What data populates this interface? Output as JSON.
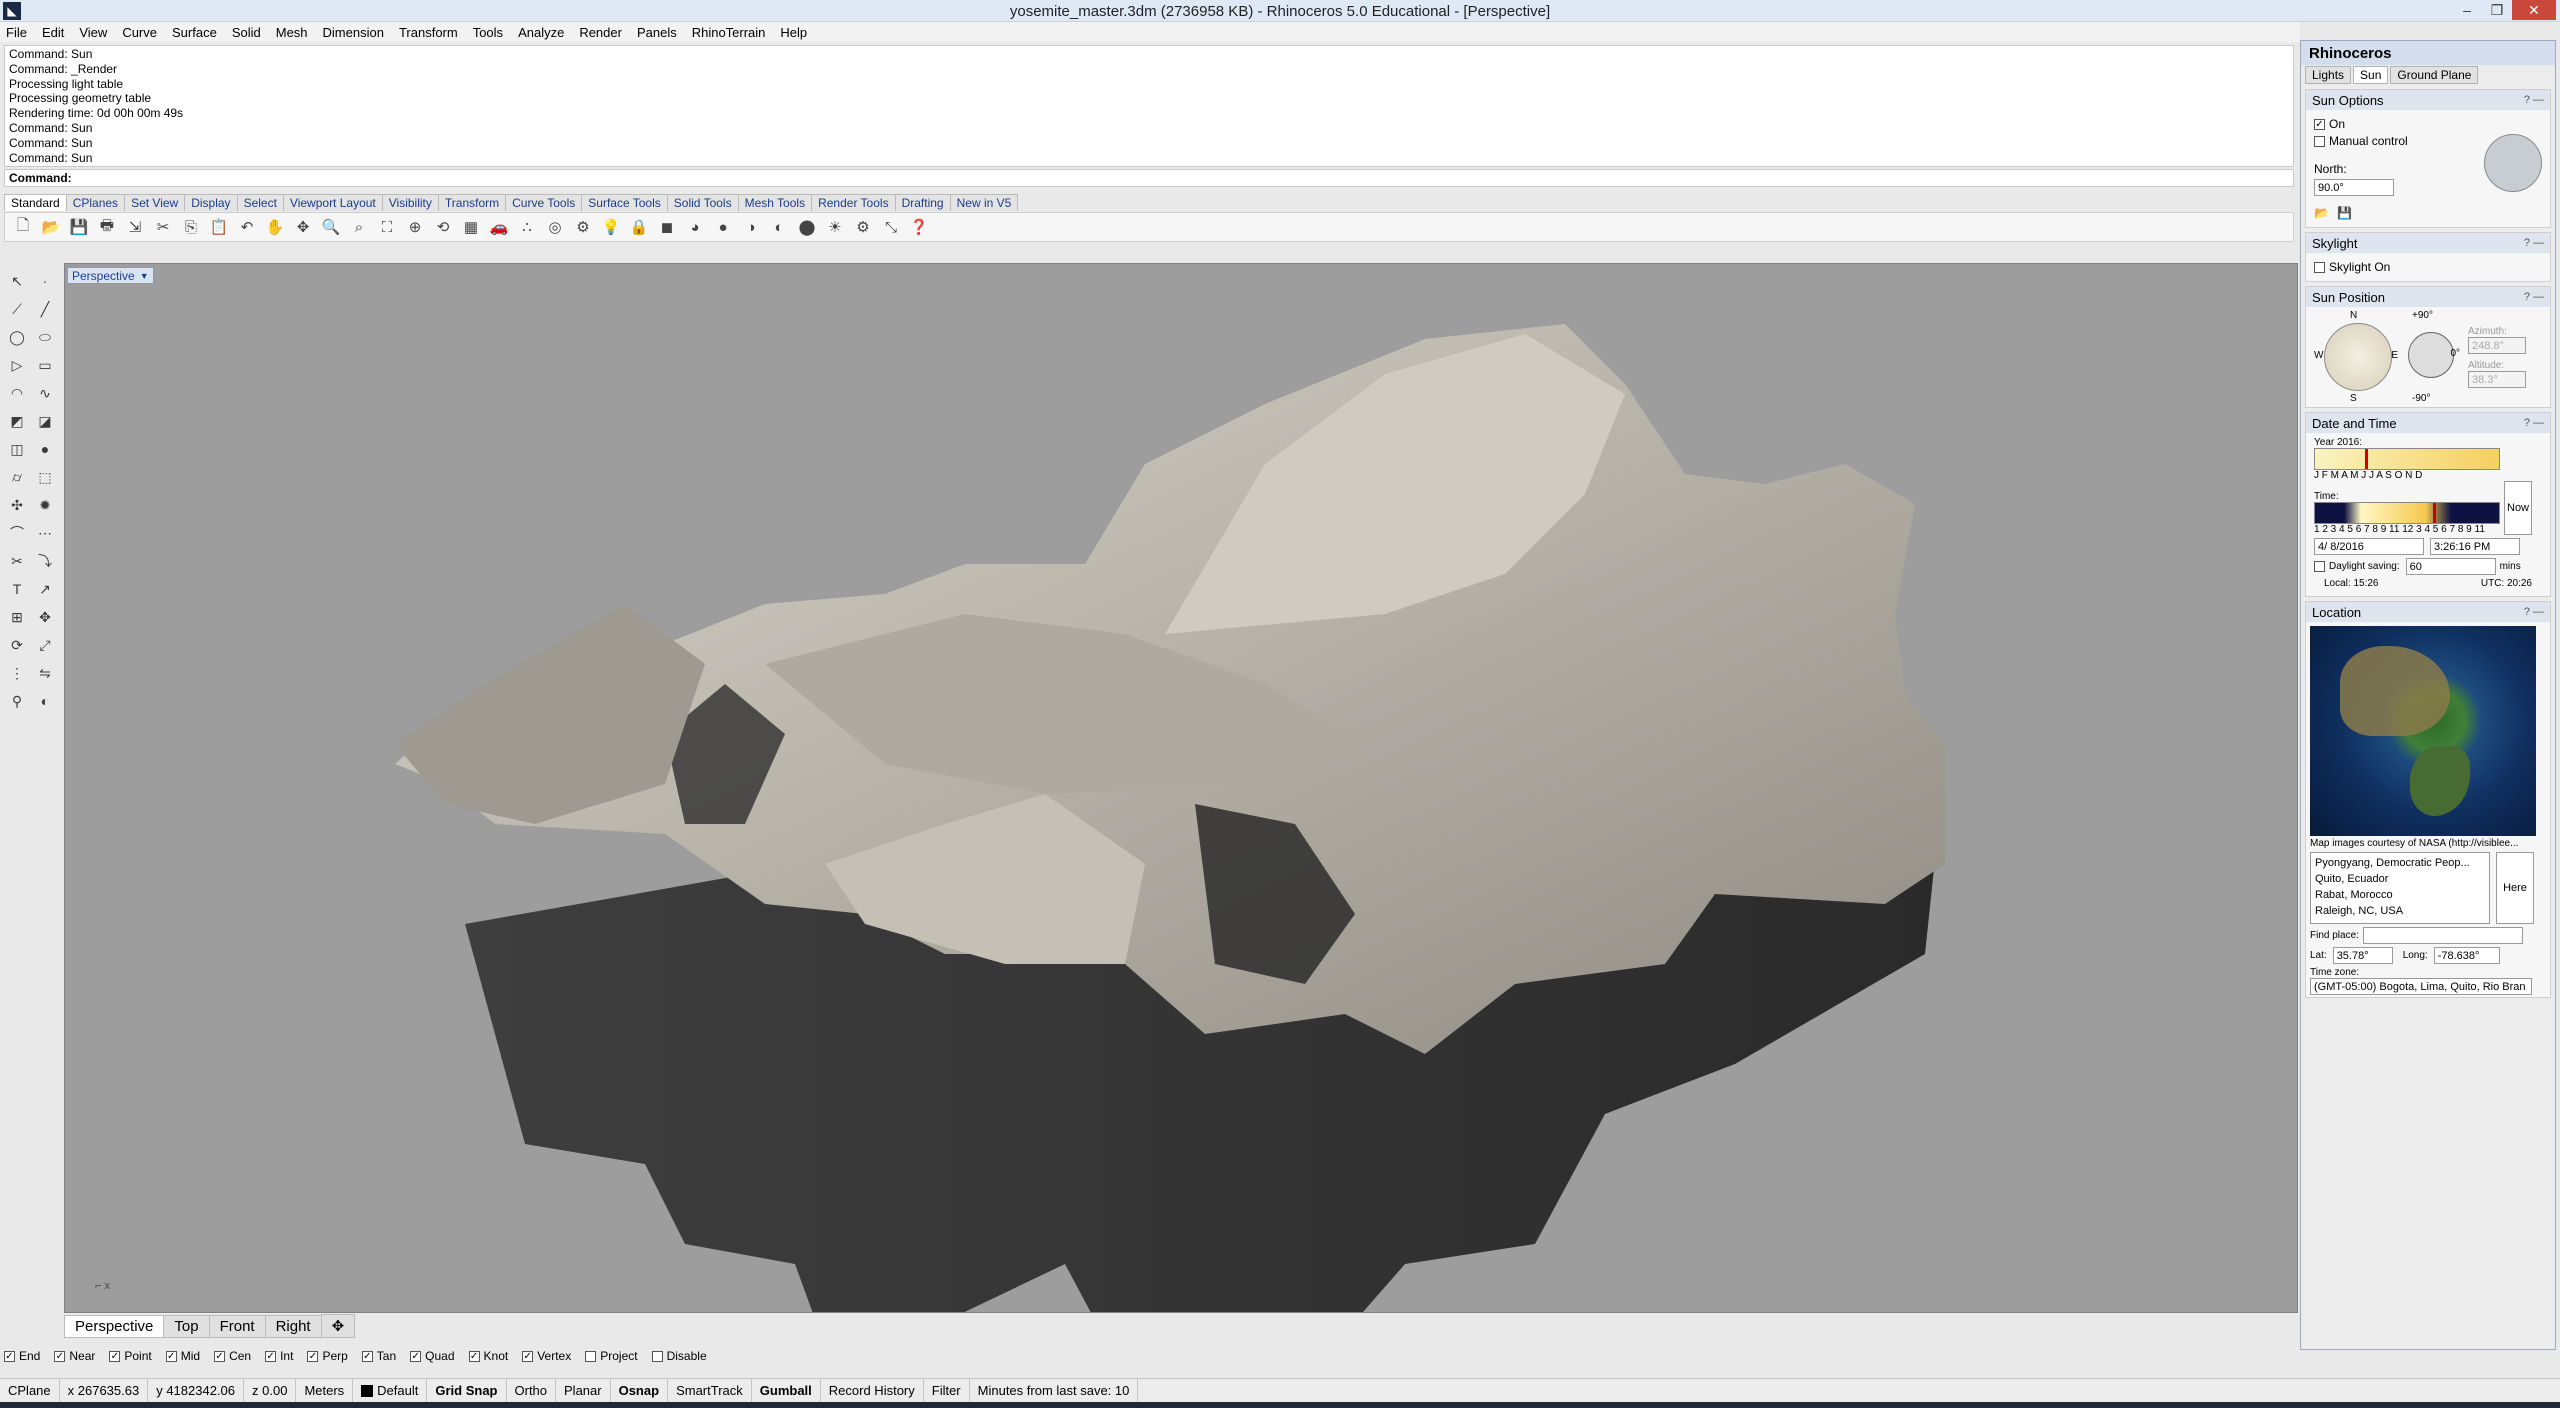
{
  "title_bar": {
    "title": "yosemite_master.3dm (2736958 KB) - Rhinoceros 5.0 Educational - [Perspective]"
  },
  "menu": [
    "File",
    "Edit",
    "View",
    "Curve",
    "Surface",
    "Solid",
    "Mesh",
    "Dimension",
    "Transform",
    "Tools",
    "Analyze",
    "Render",
    "Panels",
    "RhinoTerrain",
    "Help"
  ],
  "command_history": [
    "Command: Sun",
    "Command: _Render",
    "Processing light table",
    "Processing geometry table",
    "Rendering time: 0d 00h 00m 49s",
    "Command: Sun",
    "Command: Sun",
    "Command: Sun"
  ],
  "command_prompt": "Command:",
  "toolbar_tabs": [
    "Standard",
    "CPlanes",
    "Set View",
    "Display",
    "Select",
    "Viewport Layout",
    "Visibility",
    "Transform",
    "Curve Tools",
    "Surface Tools",
    "Solid Tools",
    "Mesh Tools",
    "Render Tools",
    "Drafting",
    "New in V5"
  ],
  "viewport": {
    "label": "Perspective",
    "axis_x": "x"
  },
  "view_tabs": [
    "Perspective",
    "Top",
    "Front",
    "Right"
  ],
  "osnaps": [
    {
      "label": "End",
      "checked": true
    },
    {
      "label": "Near",
      "checked": true
    },
    {
      "label": "Point",
      "checked": true
    },
    {
      "label": "Mid",
      "checked": true
    },
    {
      "label": "Cen",
      "checked": true
    },
    {
      "label": "Int",
      "checked": true
    },
    {
      "label": "Perp",
      "checked": true
    },
    {
      "label": "Tan",
      "checked": true
    },
    {
      "label": "Quad",
      "checked": true
    },
    {
      "label": "Knot",
      "checked": true
    },
    {
      "label": "Vertex",
      "checked": true
    },
    {
      "label": "Project",
      "checked": false
    },
    {
      "label": "Disable",
      "checked": false
    }
  ],
  "status": {
    "cplane": "CPlane",
    "x": "x 267635.63",
    "y": "y 4182342.06",
    "z": "z 0.00",
    "units": "Meters",
    "layer": "Default",
    "grid_snap": "Grid Snap",
    "ortho": "Ortho",
    "planar": "Planar",
    "osnap": "Osnap",
    "smarttrack": "SmartTrack",
    "gumball": "Gumball",
    "record_history": "Record History",
    "filter": "Filter",
    "last_save": "Minutes from last save: 10"
  },
  "panel": {
    "title": "Rhinoceros",
    "tabs": [
      "Lights",
      "Sun",
      "Ground Plane"
    ],
    "sun_options": {
      "header": "Sun Options",
      "on": "On",
      "manual": "Manual control",
      "north_label": "North:",
      "north_value": "90.0°"
    },
    "skylight": {
      "header": "Skylight",
      "label": "Skylight On"
    },
    "sun_position": {
      "header": "Sun Position",
      "n": "N",
      "s": "S",
      "e": "E",
      "w": "W",
      "plus90": "+90°",
      "minus90": "-90°",
      "zero": "0°",
      "azimuth_label": "Azimuth:",
      "azimuth": "248.8°",
      "altitude_label": "Altitude:",
      "altitude": "38.3°"
    },
    "date_time": {
      "header": "Date and Time",
      "year": "Year 2016:",
      "months": "J F M A M J J A S O N D",
      "time_label": "Time:",
      "hours": "1 2 3 4 5 6 7 8 9  11 12 3 4 5 6 7 8 9  11",
      "now": "Now",
      "date": "4/ 8/2016",
      "time": "3:26:16 PM",
      "daylight": "Daylight saving:",
      "daylight_val": "60",
      "mins": "mins",
      "local": "Local: 15:26",
      "utc": "UTC: 20:26"
    },
    "location": {
      "header": "Location",
      "credit": "Map images courtesy of NASA (http://visiblee...",
      "places": [
        "Pyongyang, Democratic Peop...",
        "Quito, Ecuador",
        "Rabat, Morocco",
        "Raleigh, NC, USA"
      ],
      "here": "Here",
      "find_label": "Find place:",
      "lat_label": "Lat:",
      "lat": "35.78°",
      "long_label": "Long:",
      "long": "-78.638°",
      "tz_label": "Time zone:",
      "tz": "(GMT-05:00) Bogota, Lima, Quito, Rio Bran"
    }
  }
}
